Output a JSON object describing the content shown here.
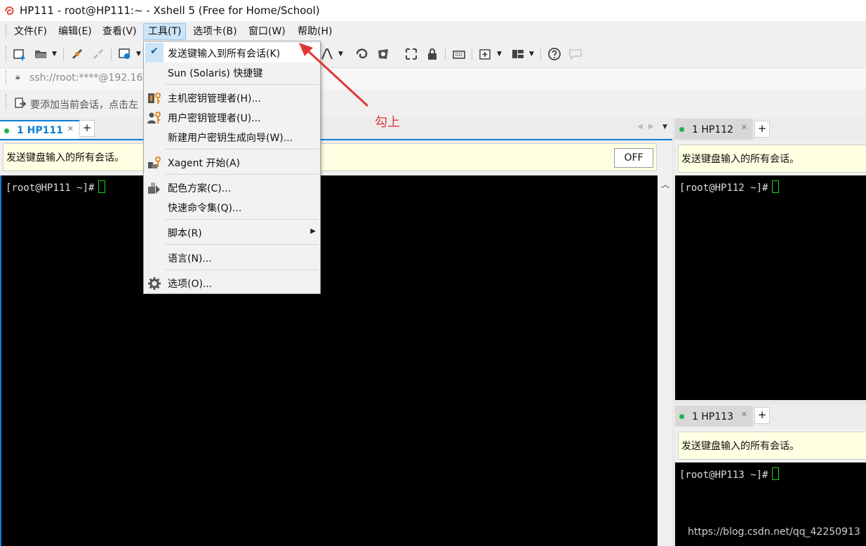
{
  "window": {
    "title": "HP111 - root@HP111:~ - Xshell 5 (Free for Home/School)"
  },
  "menu": [
    {
      "label": "文件(F)"
    },
    {
      "label": "编辑(E)"
    },
    {
      "label": "查看(V)"
    },
    {
      "label": "工具(T)"
    },
    {
      "label": "选项卡(B)"
    },
    {
      "label": "窗口(W)"
    },
    {
      "label": "帮助(H)"
    }
  ],
  "address": {
    "text": "ssh://root:****@192.16"
  },
  "hint": {
    "text": "要添加当前会话，点击左"
  },
  "tools_menu": {
    "items": [
      {
        "label": "发送键输入到所有会话(K)",
        "checked": true
      },
      {
        "label": "Sun (Solaris) 快捷键"
      },
      {
        "label": "主机密钥管理者(H)..."
      },
      {
        "label": "用户密钥管理者(U)..."
      },
      {
        "label": "新建用户密钥生成向导(W)..."
      },
      {
        "label": "Xagent 开始(A)"
      },
      {
        "label": "配色方案(C)..."
      },
      {
        "label": "快速命令集(Q)..."
      },
      {
        "label": "脚本(R)"
      },
      {
        "label": "语言(N)..."
      },
      {
        "label": "选项(O)..."
      }
    ]
  },
  "sessions": {
    "left": {
      "tab": "1 HP111",
      "broadcast": "发送键盘输入的所有会话。",
      "toggle": "OFF",
      "prompt": "[root@HP111 ~]#"
    },
    "right_top": {
      "tab": "1 HP112",
      "broadcast": "发送键盘输入的所有会话。",
      "prompt": "[root@HP112 ~]#"
    },
    "right_bottom": {
      "tab": "1 HP113",
      "broadcast": "发送键盘输入的所有会话。",
      "prompt": "[root@HP113 ~]#"
    },
    "add_tab": "+"
  },
  "annotation": {
    "text": "勾上",
    "color": "#e23636"
  },
  "watermark": "https://blog.csdn.net/qq_42250913",
  "colors": {
    "accent": "#0a7fd6",
    "menu_active": "#cce4f7",
    "broadcast_bg": "#ffffe1",
    "session_dot": "#21b24a",
    "cursor": "#1ed01e"
  }
}
